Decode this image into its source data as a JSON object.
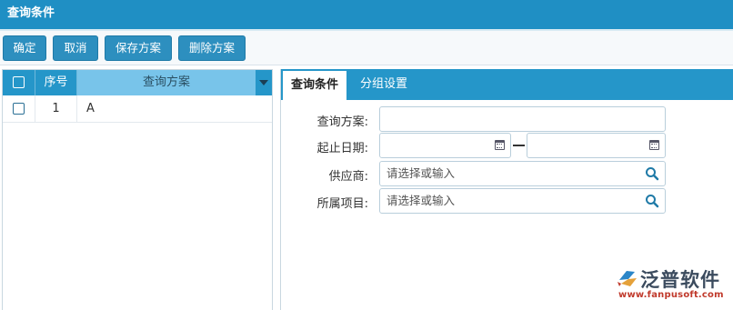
{
  "window": {
    "title": "查询条件"
  },
  "toolbar": {
    "confirm_label": "确定",
    "cancel_label": "取消",
    "save_plan_label": "保存方案",
    "delete_plan_label": "删除方案"
  },
  "plan_grid": {
    "columns": {
      "seq": "序号",
      "plan": "查询方案"
    },
    "rows": [
      {
        "seq": "1",
        "plan": "A",
        "checked": false
      }
    ]
  },
  "tabs": [
    {
      "label": "查询条件",
      "active": true
    },
    {
      "label": "分组设置",
      "active": false
    }
  ],
  "form": {
    "plan_name": {
      "label": "查询方案:",
      "value": ""
    },
    "date_range": {
      "label": "起止日期:",
      "start": "",
      "end": "",
      "separator": "—"
    },
    "supplier": {
      "label": "供应商:",
      "placeholder": "请选择或输入"
    },
    "project": {
      "label": "所属项目:",
      "placeholder": "请选择或输入"
    }
  },
  "logo": {
    "name": "泛普软件",
    "url": "www.fanpusoft.com"
  },
  "colors": {
    "header": "#1f8fc4",
    "button": "#2d8fbf",
    "grid_header": "#2596c9",
    "active_column": "#78c4ea",
    "logo_url": "#c0392b"
  },
  "icons": {
    "date": "calendar-icon",
    "search": "search-icon",
    "sort": "caret-down-icon"
  }
}
